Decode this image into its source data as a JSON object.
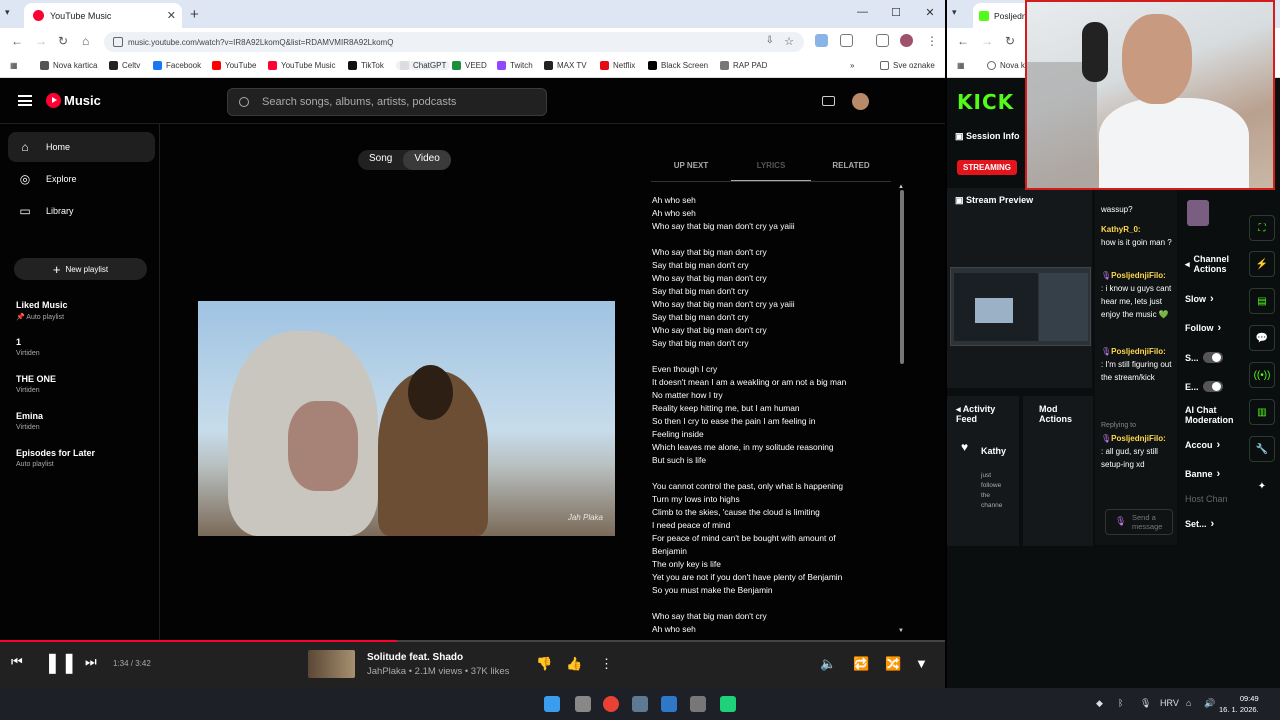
{
  "left_browser": {
    "tab_title": "YouTube Music",
    "url": "music.youtube.com/watch?v=IR8A92LkomQ&list=RDAMVMIR8A92LkomQ",
    "bookmarks": [
      {
        "label": "Nova kartica",
        "color": "#555555"
      },
      {
        "label": "Celtv",
        "color": "#222222"
      },
      {
        "label": "Facebook",
        "color": "#1877f2"
      },
      {
        "label": "YouTube",
        "color": "#ff0000"
      },
      {
        "label": "YouTube Music",
        "color": "#ff0033"
      },
      {
        "label": "TikTok",
        "color": "#111111"
      },
      {
        "label": "ChatGPT",
        "color": "#dddddd"
      },
      {
        "label": "VEED",
        "color": "#1a8f3c"
      },
      {
        "label": "Twitch",
        "color": "#9146ff"
      },
      {
        "label": "MAX TV",
        "color": "#222222"
      },
      {
        "label": "Netflix",
        "color": "#e50914"
      },
      {
        "label": "Black Screen",
        "color": "#000000"
      },
      {
        "label": "RAP PAD",
        "color": "#777777"
      }
    ],
    "bookmarks_more": "Sve oznake"
  },
  "ytm": {
    "logo_text": "Music",
    "search_placeholder": "Search songs, albums, artists, podcasts",
    "nav": [
      {
        "label": "Home",
        "icon": "⌂"
      },
      {
        "label": "Explore",
        "icon": "◎"
      },
      {
        "label": "Library",
        "icon": "▭"
      }
    ],
    "new_playlist": "New playlist",
    "playlists": [
      {
        "title": "Liked Music",
        "sub": "Auto playlist"
      },
      {
        "title": "1",
        "sub": "Virtiden"
      },
      {
        "title": "THE ONE",
        "sub": "Virtiden"
      },
      {
        "title": "Emina",
        "sub": "Virtiden"
      },
      {
        "title": "Episodes for Later",
        "sub": "Auto playlist"
      }
    ],
    "toggle": {
      "song": "Song",
      "video": "Video"
    },
    "video_watermark": "Jah Plaka",
    "tabs": {
      "up_next": "UP NEXT",
      "lyrics": "LYRICS",
      "related": "RELATED"
    },
    "lyrics": [
      "Ah who seh",
      "Ah who seh",
      "Who say that big man don't cry ya yaiii",
      "",
      "Who say that big man don't cry",
      "Say that big man don't cry",
      "Who say that big man don't cry",
      "Say that big man don't cry",
      "Who say that big man don't cry ya yaiii",
      "Say that big man don't cry",
      "Who say that big man don't cry",
      "Say that big man don't cry",
      "",
      "Even though I cry",
      "It doesn't mean I am a weakling or am not a big man",
      "No matter how I try",
      "Reality keep hitting me, but I am human",
      "So then I cry to ease the pain I am feeling in",
      "Feeling inside",
      "Which leaves me alone, in my solitude reasoning",
      "But such is life",
      "",
      "You cannot control the past, only what is happening",
      "Turn my lows into highs",
      "Climb to the skies, 'cause the cloud is limiting",
      "I need peace of mind",
      "For peace of mind can't be bought with amount of",
      "Benjamin",
      "The only key is life",
      "Yet you are not if you don't have plenty of Benjamin",
      "So you must make the Benjamin",
      "",
      "Who say that big man don't cry",
      "Ah who seh"
    ],
    "player": {
      "time": "1:34 / 3:42",
      "progress": 0.42,
      "title": "Solitude feat. Shado",
      "subtitle": "JahPlaka • 2.1M views • 37K likes"
    }
  },
  "right_browser": {
    "tab_title": "Posljedn",
    "bookmark_item": "Nova k",
    "kick_logo": "KICK",
    "session_info": "Session Info",
    "streaming_badge": "STREAMING",
    "stream_preview": "Stream Preview",
    "activity_feed": "Activity Feed",
    "mod_actions": "Mod Actions",
    "feed_user": "Kathy",
    "feed_msg": "just followe the channe",
    "chat": [
      {
        "user": "",
        "text": "wassup?"
      },
      {
        "user": "KathyR_0:",
        "text": "how is it goin man ?"
      },
      {
        "user": "PosljednjiFilo:",
        "text": ": i know u guys cant hear me, lets just enjoy the music 💚"
      },
      {
        "user": "PosljednjiFilo:",
        "text": ": I'm still figuring out the stream/kick"
      },
      {
        "reply": "Replying to",
        "user": "PosljednjiFilo:",
        "text": ": all gud, sry still setup-ing xd"
      }
    ],
    "chat_placeholder": "Send a message",
    "channel_actions": "Channel Actions",
    "actions": [
      {
        "label": "Slow",
        "type": "arrow"
      },
      {
        "label": "Follow",
        "type": "arrow"
      },
      {
        "label": "S...",
        "type": "switch"
      },
      {
        "label": "E...",
        "type": "switch"
      },
      {
        "label": "AI Chat Moderation",
        "type": "text"
      },
      {
        "label": "Accou",
        "type": "arrow"
      },
      {
        "label": "Banne",
        "type": "arrow"
      },
      {
        "label": "Host Chan",
        "type": "dim"
      },
      {
        "label": "Set...",
        "type": "arrow"
      }
    ]
  },
  "taskbar": {
    "tray_lang": "HRV",
    "time": "09:49",
    "date": "16. 1. 2026."
  }
}
